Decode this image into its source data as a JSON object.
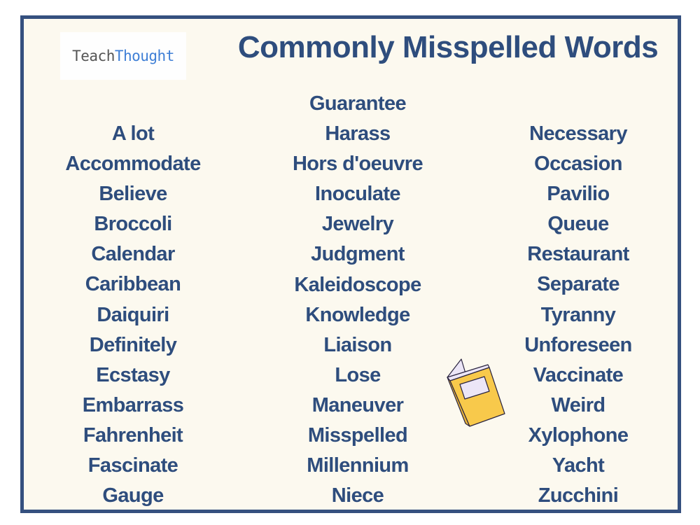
{
  "logo": {
    "part1": "Teach",
    "part2": "Thought"
  },
  "title": "Commonly Misspelled Words",
  "colors": {
    "frame": "#35507f",
    "text": "#2e4d7d",
    "background": "#fcf9ef",
    "logo_accent": "#3f7fd6",
    "book": "#f8c94b"
  },
  "columns": [
    {
      "words": [
        "A lot",
        "Accommodate",
        "Believe",
        "Broccoli",
        "Calendar",
        "Caribbean",
        "Daiquiri",
        "Definitely",
        "Ecstasy",
        "Embarrass",
        "Fahrenheit",
        "Fascinate",
        "Gauge"
      ]
    },
    {
      "words": [
        "Guarantee",
        "Harass",
        "Hors d'oeuvre",
        "Inoculate",
        "Jewelry",
        "Judgment",
        "Kaleidoscope",
        "Knowledge",
        "Liaison",
        "Lose",
        "Maneuver",
        "Misspelled",
        "Millennium",
        "Niece"
      ]
    },
    {
      "words": [
        "Necessary",
        "Occasion",
        "Pavilio",
        "Queue",
        "Restaurant",
        "Separate",
        "Tyranny",
        "Unforeseen",
        "Vaccinate",
        "Weird",
        "Xylophone",
        "Yacht",
        "Zucchini"
      ]
    }
  ],
  "icons": {
    "book": "book-icon",
    "watermark": "browser-check-watermark"
  }
}
